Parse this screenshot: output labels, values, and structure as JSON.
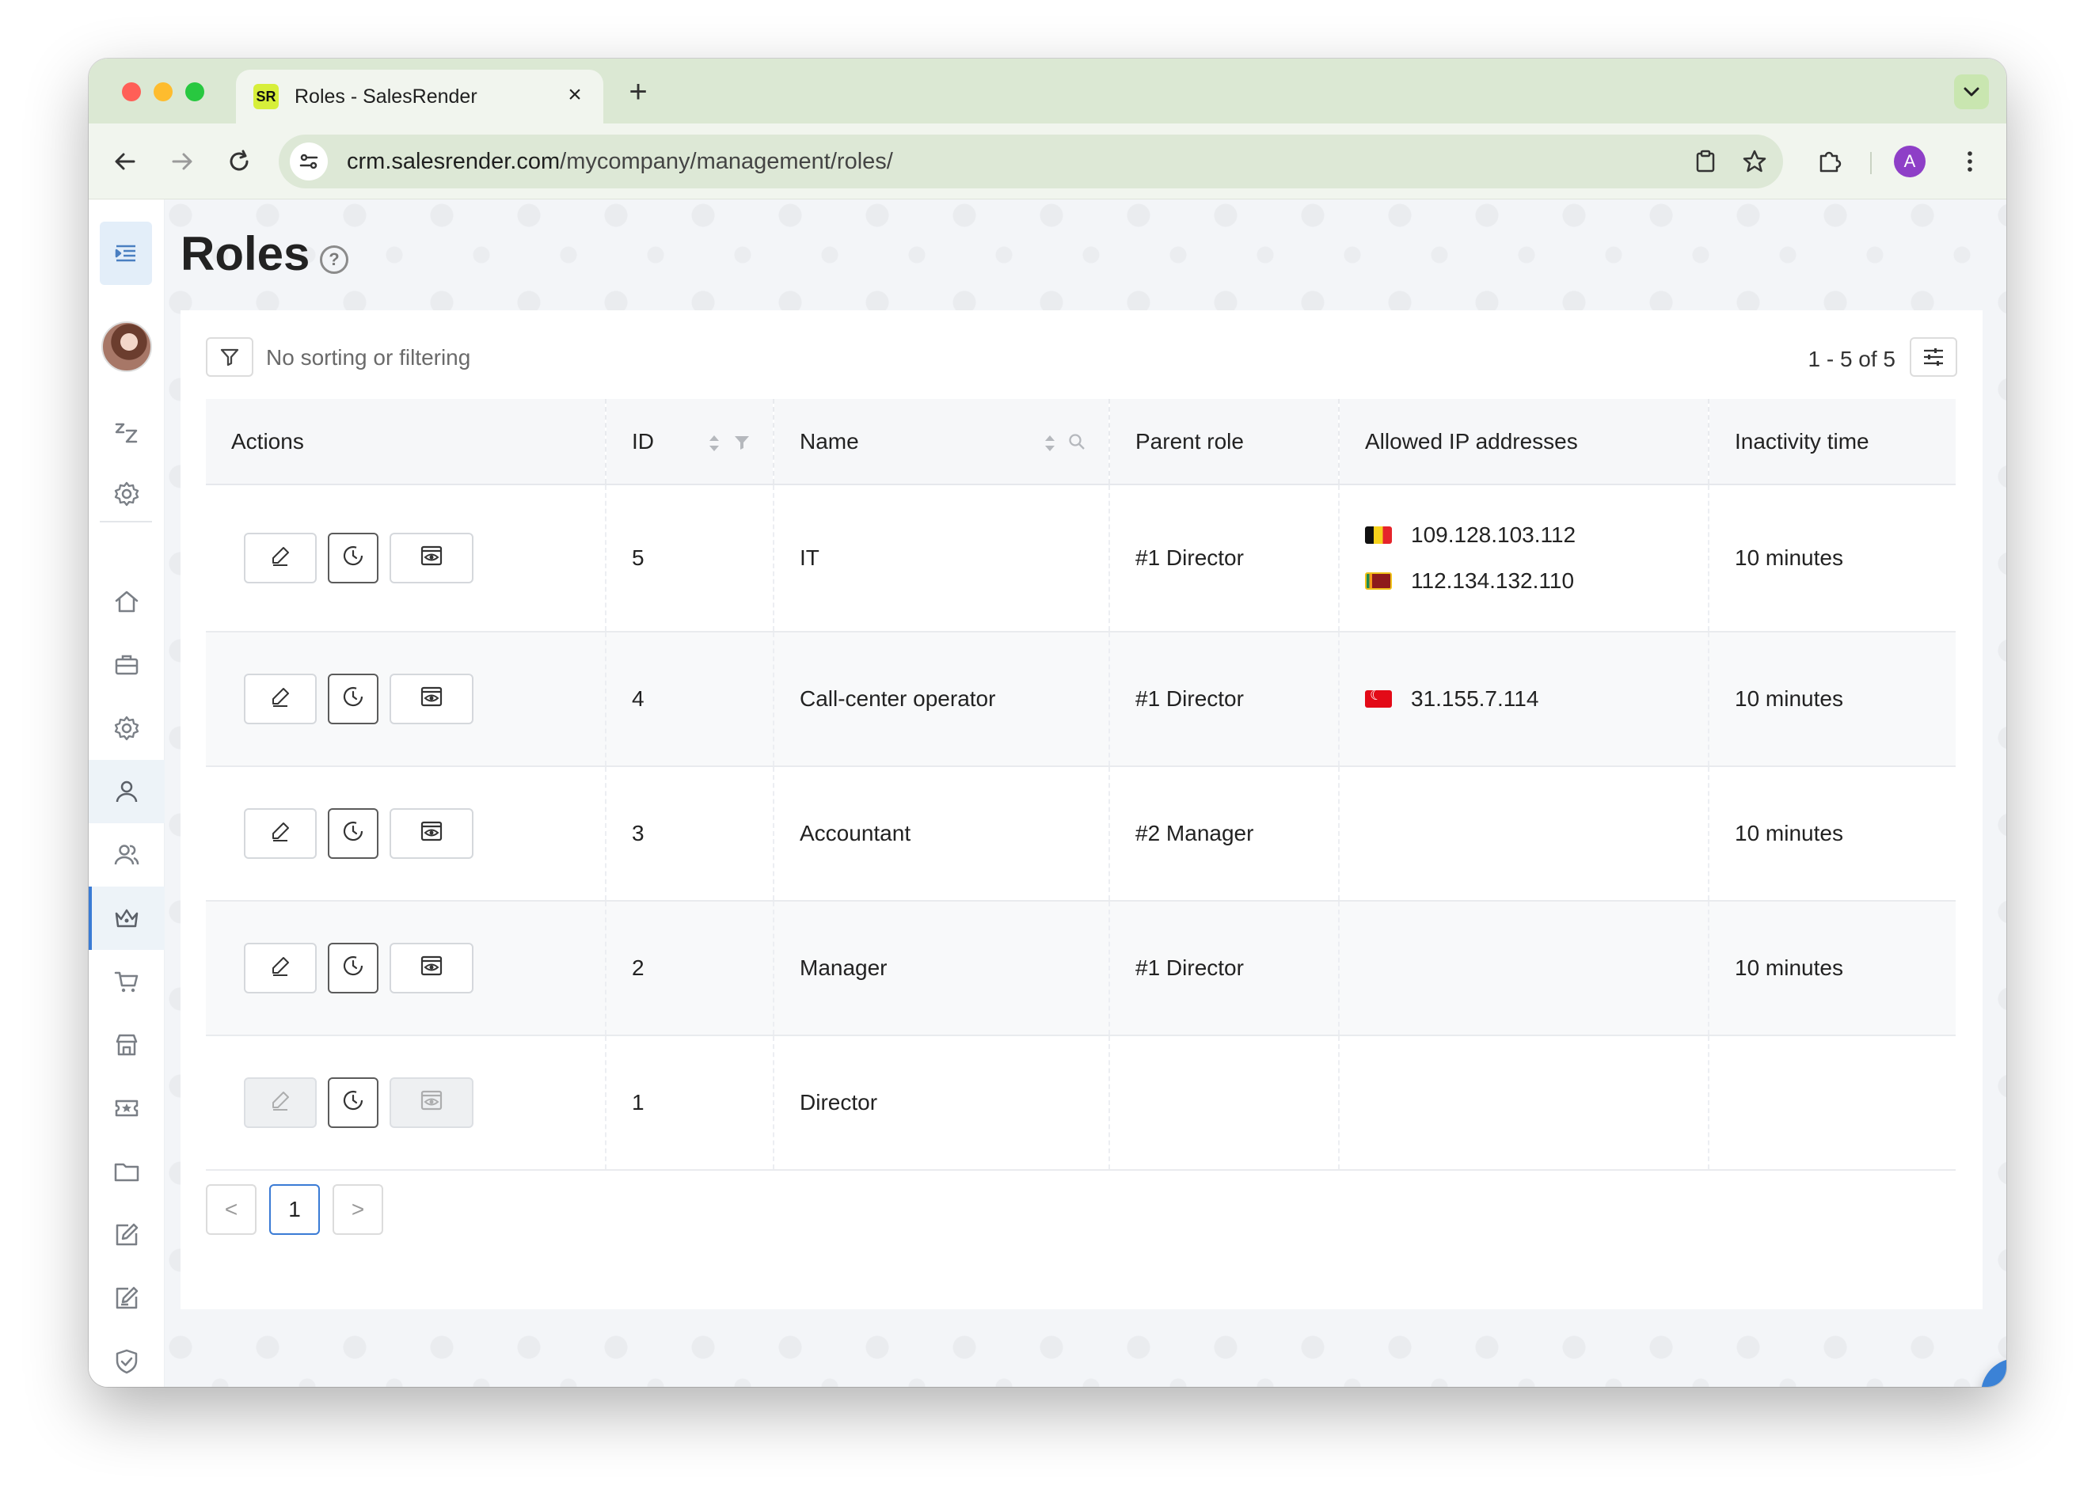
{
  "browser": {
    "tab_title": "Roles - SalesRender",
    "favicon_text": "SR",
    "url_domain": "crm.salesrender.com",
    "url_path": "/mycompany/management/roles/",
    "profile_initial": "A"
  },
  "page": {
    "title": "Roles",
    "help_symbol": "?"
  },
  "toolbar": {
    "filter_status": "No sorting or filtering",
    "paging_info": "1 - 5 of 5"
  },
  "table": {
    "columns": [
      "Actions",
      "ID",
      "Name",
      "Parent role",
      "Allowed IP addresses",
      "Inactivity time"
    ],
    "rows": [
      {
        "id": "5",
        "name": "IT",
        "parent": "#1 Director",
        "ips": [
          {
            "flag": "belgium",
            "ip": "109.128.103.112"
          },
          {
            "flag": "sri-lanka",
            "ip": "112.134.132.110"
          }
        ],
        "inactivity": "10 minutes",
        "editable": true
      },
      {
        "id": "4",
        "name": "Call-center operator",
        "parent": "#1 Director",
        "ips": [
          {
            "flag": "turkey",
            "ip": "31.155.7.114"
          }
        ],
        "inactivity": "10 minutes",
        "editable": true
      },
      {
        "id": "3",
        "name": "Accountant",
        "parent": "#2 Manager",
        "ips": [],
        "inactivity": "10 minutes",
        "editable": true
      },
      {
        "id": "2",
        "name": "Manager",
        "parent": "#1 Director",
        "ips": [],
        "inactivity": "10 minutes",
        "editable": true
      },
      {
        "id": "1",
        "name": "Director",
        "parent": "",
        "ips": [],
        "inactivity": "",
        "editable": false
      }
    ]
  },
  "pagination": {
    "prev": "<",
    "current": "1",
    "next": ">"
  },
  "sidebar": {
    "items": [
      "menu-toggle",
      "user-avatar",
      "sleep-icon",
      "settings-icon",
      "home-icon",
      "briefcase-icon",
      "gear-icon",
      "user-icon",
      "users-icon",
      "crown-icon",
      "cart-icon",
      "store-icon",
      "ticket-icon",
      "folder-icon",
      "edit-icon",
      "edit-check-icon",
      "shield-check-icon"
    ],
    "active": "crown-icon"
  },
  "colors": {
    "accent": "#3b82d6",
    "tabbar": "#dbe8d3",
    "toolbar": "#f1f5ee"
  }
}
